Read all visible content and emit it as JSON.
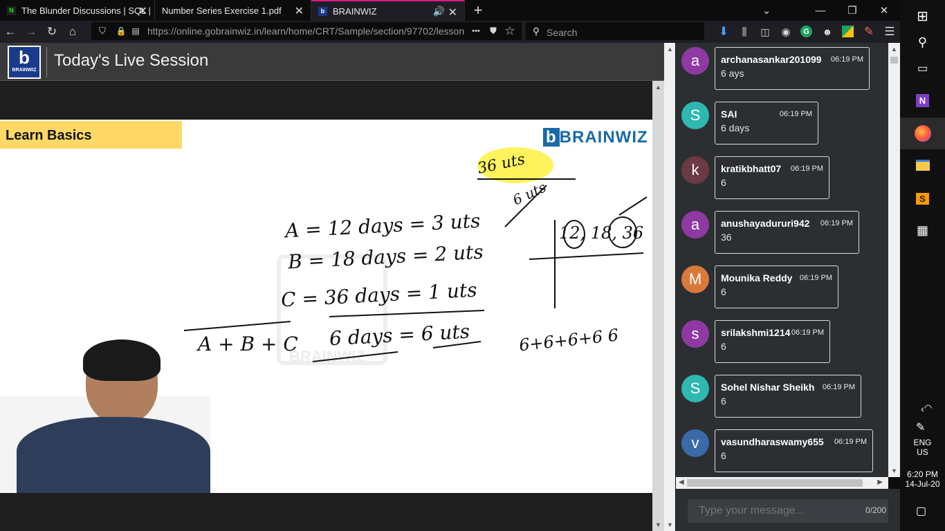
{
  "tabs": [
    {
      "title": "The Blunder Discussions | SQL |",
      "icon": "notion-icon"
    },
    {
      "title": "Number Series Exercise 1.pdf",
      "icon": "pdf-icon"
    },
    {
      "title": "BRAINWIZ",
      "icon": "brainwiz-icon"
    }
  ],
  "nav": {
    "url": "https://online.gobrainwiz.in/learn/home/CRT/Sample/section/97702/lesson/",
    "search_placeholder": "Search",
    "more": "•••"
  },
  "page": {
    "title": "Today's Live Session",
    "logo_text": "BRAINWIZ",
    "video_banner": "Learn Basics",
    "video_watermark": "BRAINWIZ"
  },
  "whiteboard": {
    "line1": "A = 12 days = 3 uts",
    "line2": "B = 18 days = 2 uts",
    "line3": "C = 36 days = 1 uts",
    "line4": "A + B + C",
    "line5": "6 days = 6 uts",
    "top_a": "36 uts",
    "top_b": "6 uts",
    "lcm": "12, 18, 36",
    "bottom": "6+6+6+6 6"
  },
  "chat": {
    "messages": [
      {
        "initial": "a",
        "color": "#8e3aa2",
        "user": "archanasankar201099",
        "time": "06:19 PM",
        "text": "6 ays"
      },
      {
        "initial": "S",
        "color": "#2eb8b0",
        "user": "SAI",
        "time": "06:19 PM",
        "text": "6 days"
      },
      {
        "initial": "k",
        "color": "#6b3a45",
        "user": "kratikbhatt07",
        "time": "06:19 PM",
        "text": "6"
      },
      {
        "initial": "a",
        "color": "#8e3aa2",
        "user": "anushayadururi942",
        "time": "06:19 PM",
        "text": "36"
      },
      {
        "initial": "M",
        "color": "#d87a3a",
        "user": "Mounika Reddy",
        "time": "06:19 PM",
        "text": "6"
      },
      {
        "initial": "s",
        "color": "#8e3aa2",
        "user": "srilakshmi1214",
        "time": "06:19 PM",
        "text": "6"
      },
      {
        "initial": "S",
        "color": "#2eb8b0",
        "user": "Sohel Nishar Sheikh",
        "time": "06:19 PM",
        "text": "6"
      },
      {
        "initial": "v",
        "color": "#3a6aa8",
        "user": "vasundharaswamy655",
        "time": "06:19 PM",
        "text": "6"
      }
    ],
    "input_placeholder": "Type your message...",
    "counter": "0/200"
  },
  "taskbar": {
    "lang1": "ENG",
    "lang2": "US",
    "time": "6:20 PM",
    "date": "14-Jul-20"
  }
}
